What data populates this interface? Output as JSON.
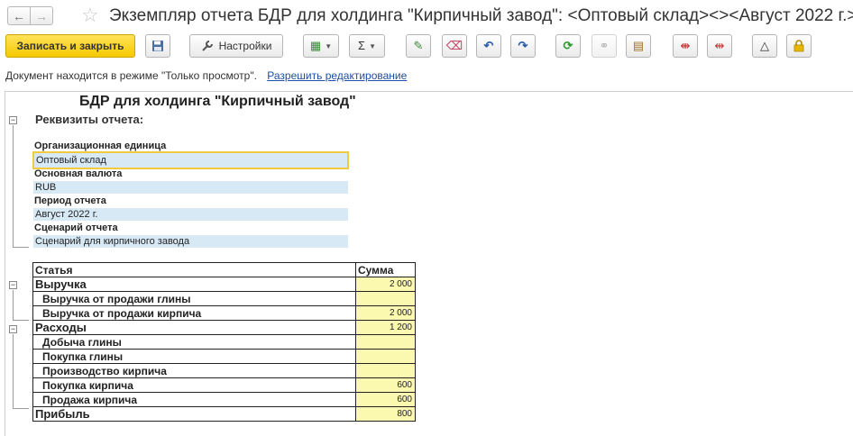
{
  "window": {
    "title": "Экземпляр отчета БДР для холдинга \"Кирпичный завод\": <Оптовый склад><><Август 2022 г.>",
    "back_glyph": "←",
    "forward_glyph": "→",
    "star_glyph": "☆"
  },
  "toolbar": {
    "save_close_label": "Записать и закрыть",
    "save_icon": "floppy-disk-icon",
    "settings_label": "Настройки",
    "settings_icon": "wrench-icon",
    "buttons": [
      {
        "name": "export-menu-button",
        "icon": "spreadsheet-icon",
        "glyph": "▦"
      },
      {
        "name": "sum-menu-button",
        "icon": "sigma-icon",
        "glyph": "Σ"
      },
      {
        "name": "edit-button",
        "icon": "pencil-icon",
        "glyph": "✎"
      },
      {
        "name": "clear-button",
        "icon": "eraser-icon",
        "glyph": "⌫"
      },
      {
        "name": "undo-button",
        "icon": "undo-arrow-icon",
        "glyph": "↶"
      },
      {
        "name": "redo-button",
        "icon": "redo-arrow-icon",
        "glyph": "↷"
      },
      {
        "name": "refresh-button",
        "icon": "refresh-icon",
        "glyph": "⟳"
      },
      {
        "name": "link-button",
        "icon": "link-icon",
        "glyph": "⚭"
      },
      {
        "name": "document-button",
        "icon": "document-icon",
        "glyph": "▤"
      },
      {
        "name": "expand-columns-button",
        "icon": "expand-columns-icon",
        "glyph": "⇼"
      },
      {
        "name": "collapse-columns-button",
        "icon": "collapse-columns-icon",
        "glyph": "⇹"
      },
      {
        "name": "delta-button",
        "icon": "triangle-icon",
        "glyph": "△"
      },
      {
        "name": "lock-button",
        "icon": "lock-icon",
        "glyph": "🔒"
      }
    ]
  },
  "mode": {
    "text": "Документ находится в режиме \"Только просмотр\".",
    "link": "Разрешить редактирование"
  },
  "report": {
    "title": "БДР для холдинга \"Кирпичный завод\"",
    "requisites_title": "Реквизиты отчета:",
    "fields": [
      {
        "label": "Организационная единица",
        "value": "Оптовый склад"
      },
      {
        "label": "Основная валюта",
        "value": "RUB"
      },
      {
        "label": "Период отчета",
        "value": "Август 2022 г."
      },
      {
        "label": "Сценарий отчета",
        "value": "Сценарий для кирпичного завода"
      }
    ]
  },
  "table": {
    "headers": [
      "Статья",
      "Сумма"
    ],
    "rows": [
      {
        "label": "Выручка",
        "value": "2 000",
        "level": "group"
      },
      {
        "label": "Выручка от продажи глины",
        "value": "",
        "level": "sub"
      },
      {
        "label": "Выручка от продажи кирпича",
        "value": "2 000",
        "level": "sub"
      },
      {
        "label": "Расходы",
        "value": "1 200",
        "level": "group"
      },
      {
        "label": "Добыча глины",
        "value": "",
        "level": "sub"
      },
      {
        "label": "Покупка глины",
        "value": "",
        "level": "sub"
      },
      {
        "label": "Производство кирпича",
        "value": "",
        "level": "sub"
      },
      {
        "label": "Покупка кирпича",
        "value": "600",
        "level": "sub"
      },
      {
        "label": "Продажа кирпича",
        "value": "600",
        "level": "sub"
      },
      {
        "label": "Прибыль",
        "value": "800",
        "level": "group"
      }
    ]
  },
  "colors": {
    "primary_button": "#f5c900",
    "field_background": "#d8e9f6",
    "value_cell_background": "#fbf8b0",
    "selection_border": "#f3c93f",
    "link": "#1f4fa0"
  }
}
